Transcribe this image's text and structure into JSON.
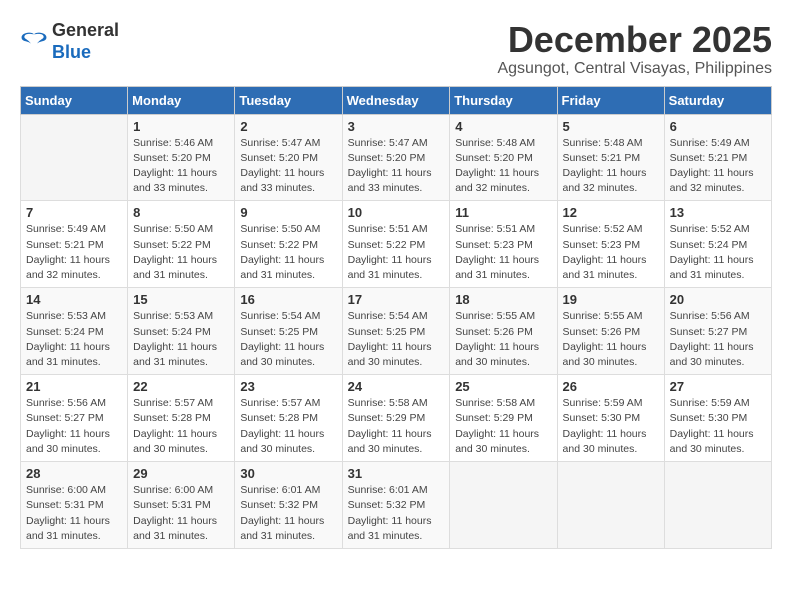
{
  "logo": {
    "general": "General",
    "blue": "Blue"
  },
  "title": "December 2025",
  "location": "Agsungot, Central Visayas, Philippines",
  "days_of_week": [
    "Sunday",
    "Monday",
    "Tuesday",
    "Wednesday",
    "Thursday",
    "Friday",
    "Saturday"
  ],
  "weeks": [
    [
      {
        "day": "",
        "info": ""
      },
      {
        "day": "1",
        "info": "Sunrise: 5:46 AM\nSunset: 5:20 PM\nDaylight: 11 hours\nand 33 minutes."
      },
      {
        "day": "2",
        "info": "Sunrise: 5:47 AM\nSunset: 5:20 PM\nDaylight: 11 hours\nand 33 minutes."
      },
      {
        "day": "3",
        "info": "Sunrise: 5:47 AM\nSunset: 5:20 PM\nDaylight: 11 hours\nand 33 minutes."
      },
      {
        "day": "4",
        "info": "Sunrise: 5:48 AM\nSunset: 5:20 PM\nDaylight: 11 hours\nand 32 minutes."
      },
      {
        "day": "5",
        "info": "Sunrise: 5:48 AM\nSunset: 5:21 PM\nDaylight: 11 hours\nand 32 minutes."
      },
      {
        "day": "6",
        "info": "Sunrise: 5:49 AM\nSunset: 5:21 PM\nDaylight: 11 hours\nand 32 minutes."
      }
    ],
    [
      {
        "day": "7",
        "info": "Sunrise: 5:49 AM\nSunset: 5:21 PM\nDaylight: 11 hours\nand 32 minutes."
      },
      {
        "day": "8",
        "info": "Sunrise: 5:50 AM\nSunset: 5:22 PM\nDaylight: 11 hours\nand 31 minutes."
      },
      {
        "day": "9",
        "info": "Sunrise: 5:50 AM\nSunset: 5:22 PM\nDaylight: 11 hours\nand 31 minutes."
      },
      {
        "day": "10",
        "info": "Sunrise: 5:51 AM\nSunset: 5:22 PM\nDaylight: 11 hours\nand 31 minutes."
      },
      {
        "day": "11",
        "info": "Sunrise: 5:51 AM\nSunset: 5:23 PM\nDaylight: 11 hours\nand 31 minutes."
      },
      {
        "day": "12",
        "info": "Sunrise: 5:52 AM\nSunset: 5:23 PM\nDaylight: 11 hours\nand 31 minutes."
      },
      {
        "day": "13",
        "info": "Sunrise: 5:52 AM\nSunset: 5:24 PM\nDaylight: 11 hours\nand 31 minutes."
      }
    ],
    [
      {
        "day": "14",
        "info": "Sunrise: 5:53 AM\nSunset: 5:24 PM\nDaylight: 11 hours\nand 31 minutes."
      },
      {
        "day": "15",
        "info": "Sunrise: 5:53 AM\nSunset: 5:24 PM\nDaylight: 11 hours\nand 31 minutes."
      },
      {
        "day": "16",
        "info": "Sunrise: 5:54 AM\nSunset: 5:25 PM\nDaylight: 11 hours\nand 30 minutes."
      },
      {
        "day": "17",
        "info": "Sunrise: 5:54 AM\nSunset: 5:25 PM\nDaylight: 11 hours\nand 30 minutes."
      },
      {
        "day": "18",
        "info": "Sunrise: 5:55 AM\nSunset: 5:26 PM\nDaylight: 11 hours\nand 30 minutes."
      },
      {
        "day": "19",
        "info": "Sunrise: 5:55 AM\nSunset: 5:26 PM\nDaylight: 11 hours\nand 30 minutes."
      },
      {
        "day": "20",
        "info": "Sunrise: 5:56 AM\nSunset: 5:27 PM\nDaylight: 11 hours\nand 30 minutes."
      }
    ],
    [
      {
        "day": "21",
        "info": "Sunrise: 5:56 AM\nSunset: 5:27 PM\nDaylight: 11 hours\nand 30 minutes."
      },
      {
        "day": "22",
        "info": "Sunrise: 5:57 AM\nSunset: 5:28 PM\nDaylight: 11 hours\nand 30 minutes."
      },
      {
        "day": "23",
        "info": "Sunrise: 5:57 AM\nSunset: 5:28 PM\nDaylight: 11 hours\nand 30 minutes."
      },
      {
        "day": "24",
        "info": "Sunrise: 5:58 AM\nSunset: 5:29 PM\nDaylight: 11 hours\nand 30 minutes."
      },
      {
        "day": "25",
        "info": "Sunrise: 5:58 AM\nSunset: 5:29 PM\nDaylight: 11 hours\nand 30 minutes."
      },
      {
        "day": "26",
        "info": "Sunrise: 5:59 AM\nSunset: 5:30 PM\nDaylight: 11 hours\nand 30 minutes."
      },
      {
        "day": "27",
        "info": "Sunrise: 5:59 AM\nSunset: 5:30 PM\nDaylight: 11 hours\nand 30 minutes."
      }
    ],
    [
      {
        "day": "28",
        "info": "Sunrise: 6:00 AM\nSunset: 5:31 PM\nDaylight: 11 hours\nand 31 minutes."
      },
      {
        "day": "29",
        "info": "Sunrise: 6:00 AM\nSunset: 5:31 PM\nDaylight: 11 hours\nand 31 minutes."
      },
      {
        "day": "30",
        "info": "Sunrise: 6:01 AM\nSunset: 5:32 PM\nDaylight: 11 hours\nand 31 minutes."
      },
      {
        "day": "31",
        "info": "Sunrise: 6:01 AM\nSunset: 5:32 PM\nDaylight: 11 hours\nand 31 minutes."
      },
      {
        "day": "",
        "info": ""
      },
      {
        "day": "",
        "info": ""
      },
      {
        "day": "",
        "info": ""
      }
    ]
  ]
}
